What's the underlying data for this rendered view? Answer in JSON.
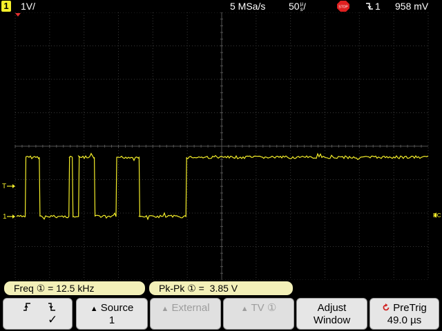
{
  "header": {
    "channel": "1",
    "scale": "1V/",
    "sample_rate": "5 MSa/s",
    "timebase": "50",
    "timebase_unit_top": "µ",
    "timebase_unit_bottom": "s",
    "run_state_icon": "stop-icon",
    "run_state_label": "STOP",
    "trigger_source": "1",
    "trigger_level": "958 mV",
    "trigger_edge_icon": "falling-edge-icon"
  },
  "markers": {
    "channel_ground": "1",
    "trigger_level_arrow": "T",
    "right_coupling": "DC"
  },
  "measurements": {
    "freq_label": "Freq",
    "freq_channel": "①",
    "freq_value": "12.5 kHz",
    "pkpk_label": "Pk-Pk",
    "pkpk_channel": "①",
    "pkpk_value": "3.85",
    "pkpk_unit": "V"
  },
  "softkeys": {
    "slope": {
      "icons": [
        "rising-edge-icon",
        "falling-edge-icon"
      ],
      "check": "✓"
    },
    "source": {
      "label": "Source",
      "value": "1"
    },
    "external": {
      "label": "External"
    },
    "tv": {
      "label": "TV",
      "suffix": "①"
    },
    "adjust": {
      "label1": "Adjust",
      "label2": "Window"
    },
    "pretrig": {
      "label": "PreTrig",
      "value": "49.0 µs"
    }
  },
  "colors": {
    "trace": "#f5ef2a",
    "grid": "#3a3a3a",
    "background": "#000000",
    "meas_bg": "#f3f0b8",
    "softkey_bg": "#e6e6e6"
  },
  "waveform": {
    "time_per_div_us": 50,
    "volts_per_div": 1,
    "high_v": 3.85,
    "low_v": 0,
    "edges": [
      {
        "t_div": 0.29,
        "level": "high"
      },
      {
        "t_div": 0.7,
        "level": "low"
      },
      {
        "t_div": 1.56,
        "level": "high"
      },
      {
        "t_div": 1.66,
        "level": "low"
      },
      {
        "t_div": 1.84,
        "level": "high"
      },
      {
        "t_div": 2.3,
        "level": "low"
      },
      {
        "t_div": 2.93,
        "level": "high"
      },
      {
        "t_div": 3.6,
        "level": "low"
      },
      {
        "t_div": 4.96,
        "level": "high"
      }
    ]
  }
}
